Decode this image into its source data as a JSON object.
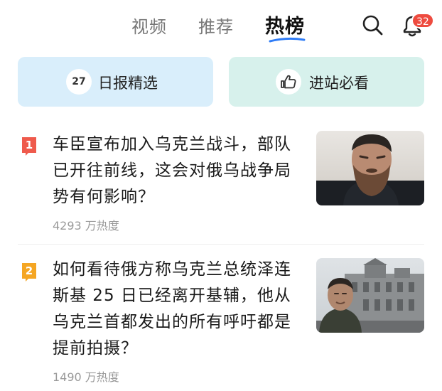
{
  "tabs": [
    {
      "label": "视频",
      "active": false
    },
    {
      "label": "推荐",
      "active": false
    },
    {
      "label": "热榜",
      "active": true
    }
  ],
  "header": {
    "search_icon": "search-icon",
    "bell_icon": "bell-icon",
    "notification_count": "32"
  },
  "cards": {
    "daily": {
      "icon_text": "27",
      "label": "日报精选"
    },
    "must_see": {
      "icon": "thumbs-up-icon",
      "label": "进站必看"
    }
  },
  "news": [
    {
      "rank": "1",
      "title": "车臣宣布加入乌克兰战斗，部队已开往前线，这会对俄乌战争局势有何影响？",
      "heat": "4293 万热度",
      "rank_color": "#ef5a4c"
    },
    {
      "rank": "2",
      "title": "如何看待俄方称乌克兰总统泽连斯基 25 日已经离开基辅，他从乌克兰首都发出的所有呼吁都是提前拍摄？",
      "heat": "1490 万热度",
      "rank_color": "#f5a623"
    }
  ],
  "colors": {
    "accent": "#2f7cf6",
    "badge": "#ee4b3f",
    "card_blue": "#d9eefb",
    "card_green": "#d7f1ec"
  }
}
